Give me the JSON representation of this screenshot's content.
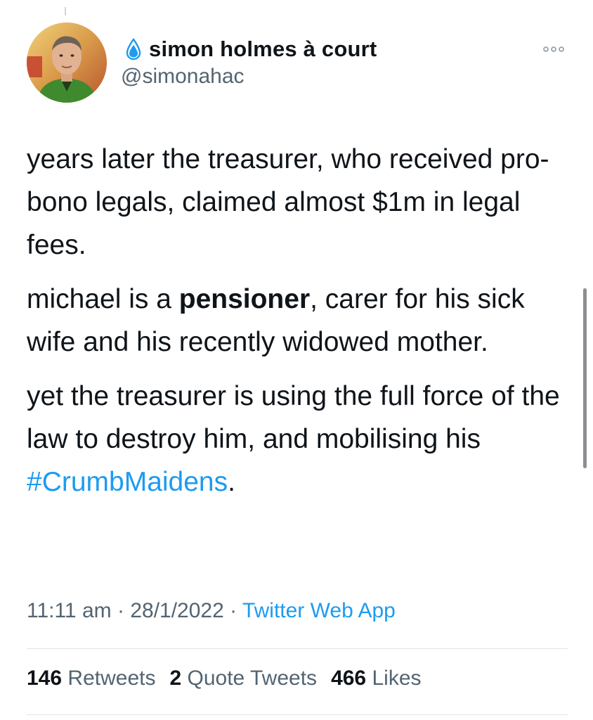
{
  "author": {
    "display_name": "simon holmes à court",
    "handle": "@simonahac",
    "badge_icon": "water-drop-icon",
    "avatar_icon": "profile-photo"
  },
  "more_icon": "more-horizontal-icon",
  "tweet": {
    "paragraphs": [
      {
        "text": "years later the treasurer, who received pro-bono legals, claimed almost $1m in legal fees."
      },
      {
        "before": "michael is a ",
        "bold": "pensioner",
        "after": ", carer for his sick wife and his recently widowed mother."
      },
      {
        "before": "yet the treasurer is using the full force of the law to destroy him, and mobilising his ",
        "hashtag": "#CrumbMaidens",
        "after": "."
      }
    ]
  },
  "meta": {
    "time": "11:11 am",
    "separator": "·",
    "date": "28/1/2022",
    "source": "Twitter Web App"
  },
  "stats": {
    "retweets_count": "146",
    "retweets_label": "Retweets",
    "quote_count": "2",
    "quote_label": "Quote Tweets",
    "likes_count": "466",
    "likes_label": "Likes"
  },
  "colors": {
    "accent": "#1d9bf0",
    "text": "#0f1419",
    "secondary": "#536471"
  }
}
